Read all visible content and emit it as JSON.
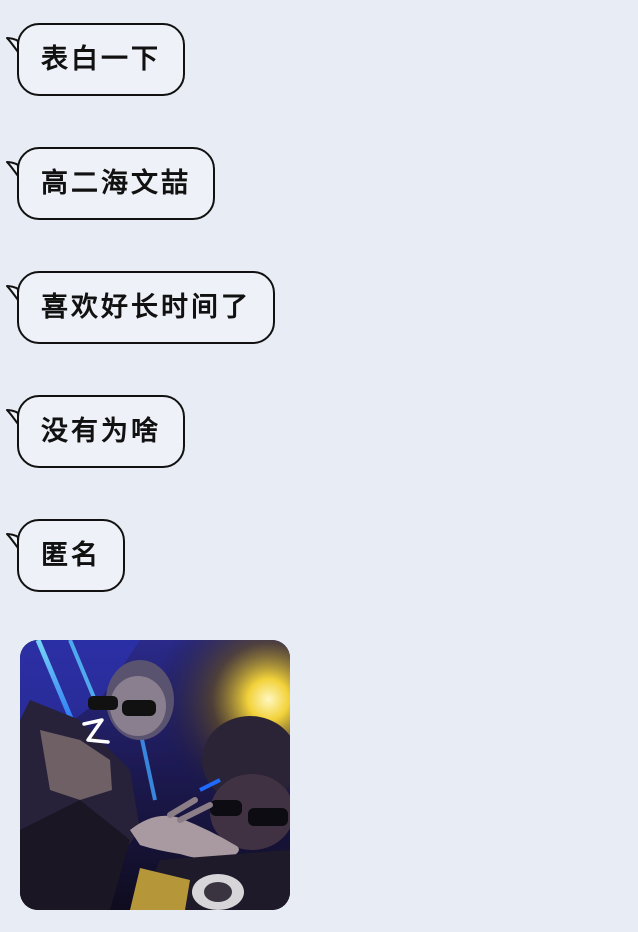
{
  "messages": [
    {
      "text": "表白一下"
    },
    {
      "text": "高二海文喆"
    },
    {
      "text": "喜欢好长时间了"
    },
    {
      "text": "没有为啥"
    },
    {
      "text": "匿名"
    }
  ],
  "image_message": {
    "photo_icon": "photo-icon",
    "mark": "2"
  }
}
